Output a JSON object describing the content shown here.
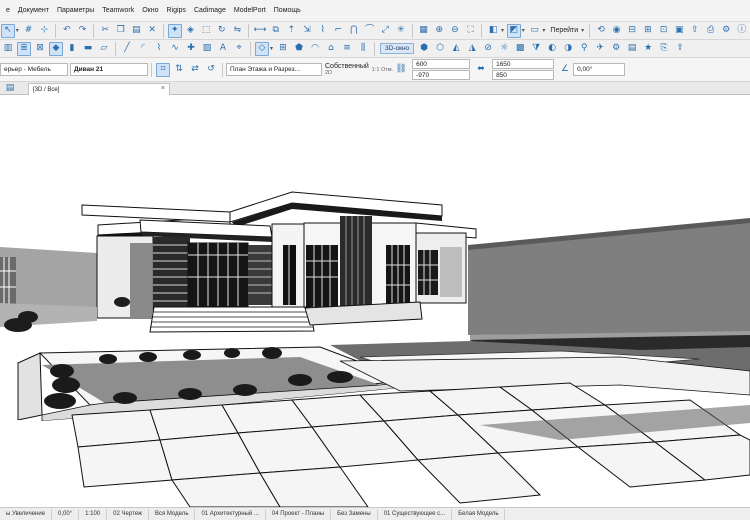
{
  "menubar": {
    "items": [
      "е",
      "Документ",
      "Параметры",
      "Teamwork",
      "Окно",
      "Rigips",
      "Cadimage",
      "ModelPort",
      "Помощь"
    ]
  },
  "toolbar1": {
    "navigate_label": "Перейти"
  },
  "toolbar2": {
    "view_3d_label": "3D-окно"
  },
  "infobox": {
    "layer_value": "ерьер - Мебель",
    "object_name": "Диван 21",
    "view_select_value": "План Этажа и Разрез...",
    "mode_label": "Собственный",
    "scale_label": "1:1 Отм.",
    "scale_small": "2D",
    "field1_value": "600",
    "field2_value": "-970",
    "field3_value": "1650",
    "field4_value": "850",
    "angle_value": "0,00°"
  },
  "tabs": {
    "active_label": "[3D / Все]"
  },
  "statusbar": {
    "items": [
      "ы Увеличение",
      "0,00°",
      "1:100",
      "02 Чертеж",
      "Вся Модель",
      "01 Архитектурный ...",
      "04 Проект - Планы",
      "Без Замены",
      "01 Существующее с...",
      "Белая Модель"
    ]
  }
}
